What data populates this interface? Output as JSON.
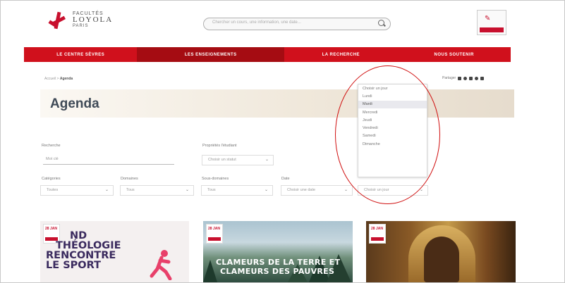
{
  "header": {
    "logo": {
      "line1": "FACULTÉS",
      "line2": "LOYOLA",
      "line3": "PARIS"
    },
    "search": {
      "placeholder": "Chercher un cours, une information, une date..."
    },
    "account_icon": "account-icon"
  },
  "nav": {
    "items": [
      {
        "label": "LE CENTRE SÈVRES",
        "active": false
      },
      {
        "label": "LES ENSEIGNEMENTS",
        "active": true
      },
      {
        "label": "LA RECHERCHE",
        "active": false
      },
      {
        "label": "NOUS SOUTENIR",
        "active": false
      }
    ]
  },
  "breadcrumb": {
    "home": "Accueil",
    "current": "Agenda"
  },
  "share": {
    "label": "Partager"
  },
  "page": {
    "title": "Agenda"
  },
  "filters": {
    "recherche": {
      "label": "Recherche",
      "placeholder": "Mot clé"
    },
    "proprietes": {
      "label": "Propriétés l'étudiant",
      "value": "Choisir un statut"
    },
    "categories": {
      "label": "Catégories",
      "value": "Toutes"
    },
    "domaines": {
      "label": "Domaines",
      "value": "Tous"
    },
    "sous_domaines": {
      "label": "Sous-domaines",
      "value": "Tous"
    },
    "date": {
      "label": "Date",
      "value": "Choisir une date"
    },
    "jour": {
      "value": "Choisir un jour"
    }
  },
  "day_dropdown": {
    "options": [
      "Choisir un jour",
      "Lundi",
      "Mardi",
      "Mercredi",
      "Jeudi",
      "Vendredi",
      "Samedi",
      "Dimanche"
    ],
    "selected_index": 2
  },
  "cards": [
    {
      "badge": "28 JAN",
      "text_lines": [
        "ND",
        "THÉOLOGIE",
        "RENCONTRE",
        "LE SPORT"
      ]
    },
    {
      "badge": "28 JAN",
      "text_lines": [
        "CLAMEURS DE LA TERRE ET",
        "CLAMEURS DES PAUVRES"
      ]
    },
    {
      "badge": "28 JAN"
    }
  ],
  "colors": {
    "brand_red": "#d0101c",
    "nav_active": "#a50c12",
    "title_text": "#3f4a57",
    "highlight_circle": "#d01010"
  }
}
